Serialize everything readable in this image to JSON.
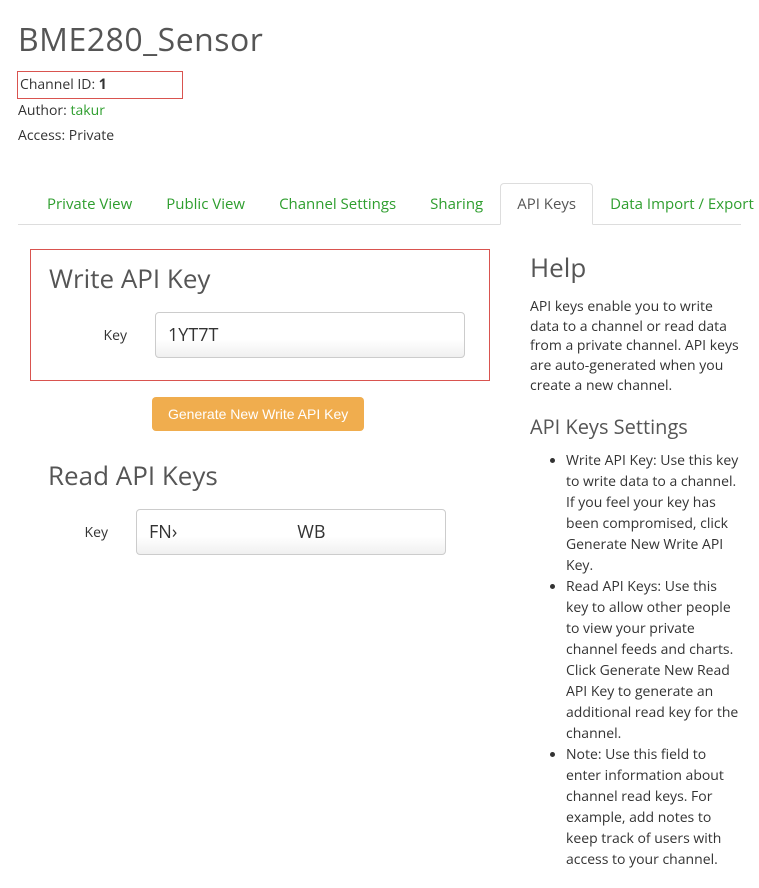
{
  "page": {
    "title": "BME280_Sensor"
  },
  "meta": {
    "channel_id_label": "Channel ID: ",
    "channel_id_value": "1",
    "author_label": "Author: ",
    "author_value": "takur",
    "access_label": "Access: ",
    "access_value": "Private"
  },
  "tabs": {
    "private_view": "Private View",
    "public_view": "Public View",
    "channel_settings": "Channel Settings",
    "sharing": "Sharing",
    "api_keys": "API Keys",
    "data_import_export": "Data Import / Export"
  },
  "write": {
    "heading": "Write API Key",
    "key_label": "Key",
    "key_value": "1YT7T",
    "generate_btn": "Generate New Write API Key"
  },
  "read": {
    "heading": "Read API Keys",
    "key_label": "Key",
    "key_value_start": "FN›",
    "key_value_end": "WB"
  },
  "help": {
    "heading": "Help",
    "intro": "API keys enable you to write data to a channel or read data from a private channel. API keys are auto-generated when you create a new channel.",
    "settings_heading": "API Keys Settings",
    "items": {
      "write": "Write API Key: Use this key to write data to a channel. If you feel your key has been compromised, click Generate New Write API Key.",
      "read": "Read API Keys: Use this key to allow other people to view your private channel feeds and charts. Click Generate New Read API Key to generate an additional read key for the channel.",
      "note": "Note: Use this field to enter information about channel read keys. For example, add notes to keep track of users with access to your channel."
    }
  }
}
